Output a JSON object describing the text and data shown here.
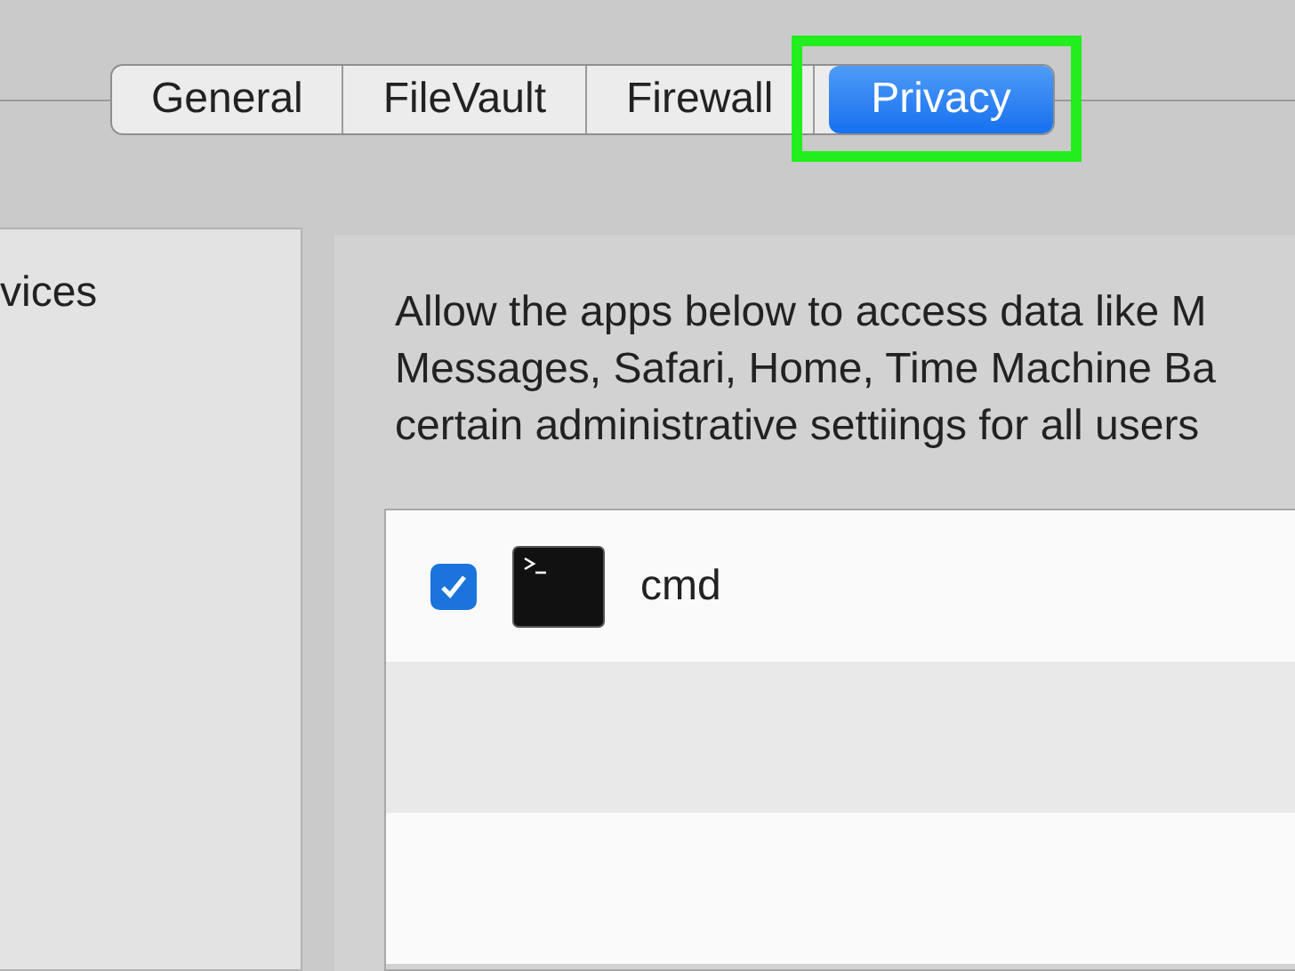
{
  "tabs": [
    {
      "label": "General",
      "selected": false,
      "highlighted": false
    },
    {
      "label": "FileVault",
      "selected": false,
      "highlighted": false
    },
    {
      "label": "Firewall",
      "selected": false,
      "highlighted": false
    },
    {
      "label": "Privacy",
      "selected": true,
      "highlighted": true
    }
  ],
  "sidebar": {
    "items": [
      {
        "label": "vices"
      }
    ]
  },
  "description": [
    "Allow the apps below to access data like M",
    "Messages, Safari, Home, Time Machine Ba",
    "certain administrative settiings for all users"
  ],
  "apps": [
    {
      "name": "cmd",
      "checked": true
    }
  ]
}
